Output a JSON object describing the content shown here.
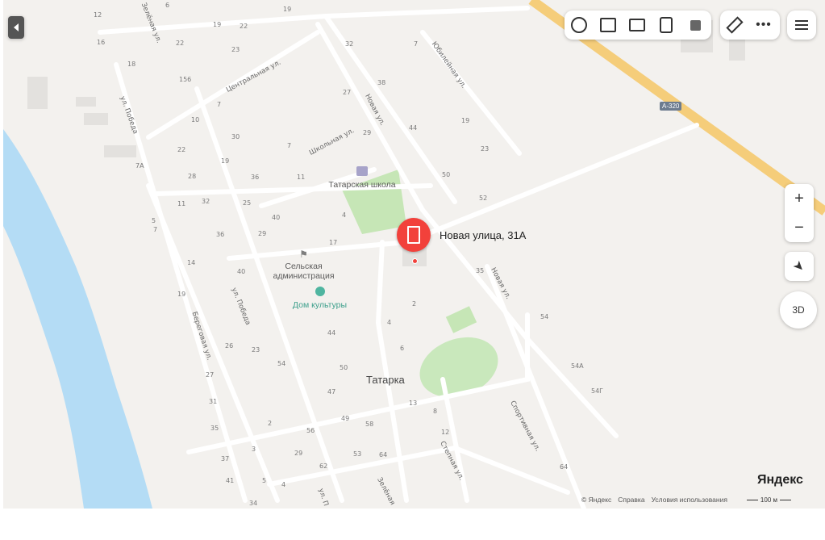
{
  "marker": {
    "label": "Новая улица, 31А"
  },
  "locality": "Татарка",
  "pois": {
    "school": "Татарская школа",
    "admin": "Сельская\nадминистрация",
    "culture": "Дом культуры"
  },
  "highway": "А-320",
  "streets": {
    "zelenaya_top": "Зелёная ул.",
    "tsentralnaya": "Центральная ул.",
    "pobedy_1": "ул. Победа",
    "pobedy_2": "ул. Победа",
    "novaya_1": "Новая ул.",
    "novaya_2": "Новая ул.",
    "shkolnaya": "Школьная ул.",
    "yubileynaya": "Юбилейная ул.",
    "beregovaya": "Береговая ул.",
    "sportivnaya": "Спортивная ул.",
    "stepnaya": "Степная ул.",
    "zelenaya_bottom": "Зелёная",
    "ul_p": "ул. П"
  },
  "house_numbers": [
    "12",
    "6",
    "19",
    "16",
    "22",
    "19",
    "22",
    "32",
    "7",
    "18",
    "23",
    "156",
    "38",
    "27",
    "7",
    "10",
    "44",
    "19",
    "30",
    "29",
    "23",
    "22",
    "7",
    "50",
    "19",
    "7A",
    "28",
    "36",
    "11",
    "52",
    "11",
    "32",
    "25",
    "40",
    "4",
    "5",
    "7",
    "36",
    "29",
    "17",
    "14",
    "40",
    "35",
    "19",
    "2",
    "54",
    "4",
    "44",
    "26",
    "23",
    "54",
    "6",
    "27",
    "50",
    "54A",
    "47",
    "54Г",
    "31",
    "13",
    "49",
    "58",
    "8",
    "35",
    "2",
    "56",
    "12",
    "3",
    "29",
    "62",
    "53",
    "64",
    "37",
    "64",
    "41",
    "5",
    "4",
    "34"
  ],
  "zoom": {
    "in": "+",
    "out": "−"
  },
  "view3d": "3D",
  "icons": {
    "layers": "layers-icon",
    "panorama": "panorama-icon",
    "photo": "camera-icon",
    "transit": "bus-icon",
    "traffic": "traffic-icon",
    "ruler": "ruler-icon",
    "more": "more-icon",
    "menu": "menu-icon",
    "collapse": "collapse-arrow-icon",
    "locate": "locate-arrow-icon"
  },
  "brand": "Яндекс",
  "footer": {
    "copyright": "© Яндекс",
    "help": "Справка",
    "terms": "Условия использования",
    "scale": "100 м"
  },
  "colors": {
    "marker": "#f2413b",
    "water": "#b4dcf5",
    "highway": "#f5cd7a",
    "green": "#cdeac0"
  }
}
